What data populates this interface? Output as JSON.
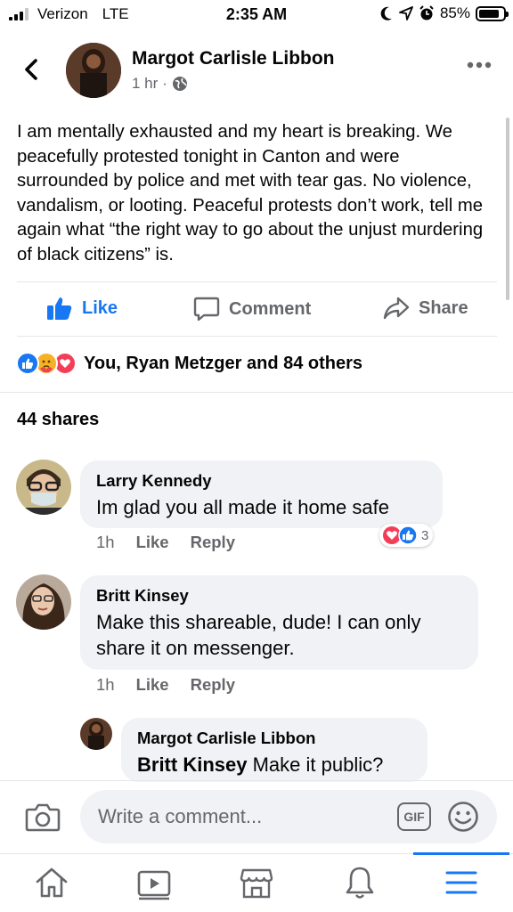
{
  "status_bar": {
    "carrier": "Verizon",
    "network": "LTE",
    "time": "2:35 AM",
    "battery": "85%",
    "battery_level": 0.85
  },
  "post": {
    "author": "Margot Carlisle Libbon",
    "time": "1 hr",
    "separator": "·",
    "audience_icon": "globe-icon",
    "text": "I am mentally exhausted and my heart is breaking. We peacefully protested tonight in Canton and were surrounded by police and met with tear gas. No violence, vandalism, or looting. Peaceful protests don’t work, tell me again what “the right way to go about the unjust murdering of black citizens” is."
  },
  "actions": {
    "like": "Like",
    "comment": "Comment",
    "share": "Share"
  },
  "reactions": {
    "icons": [
      "like-icon",
      "care-icon",
      "love-icon"
    ],
    "summary": "You, Ryan Metzger and 84 others"
  },
  "shares": "44 shares",
  "comments": [
    {
      "name": "Larry Kennedy",
      "text": "Im glad you all made it home safe",
      "time": "1h",
      "like": "Like",
      "reply": "Reply",
      "reaction_count": "3"
    },
    {
      "name": "Britt Kinsey",
      "text": "Make this shareable, dude! I can only share it on messenger.",
      "time": "1h",
      "like": "Like",
      "reply": "Reply"
    }
  ],
  "reply": {
    "name": "Margot Carlisle Libbon",
    "mention": "Britt Kinsey",
    "text": " Make it public?"
  },
  "comment_input": {
    "placeholder": "Write a comment...",
    "gif": "GIF"
  },
  "colors": {
    "accent": "#1877f2",
    "secondary_text": "#65676b",
    "bubble": "#f0f2f5",
    "love": "#f33e58"
  },
  "tabs": [
    "home-icon",
    "watch-icon",
    "marketplace-icon",
    "notifications-icon",
    "menu-icon"
  ]
}
